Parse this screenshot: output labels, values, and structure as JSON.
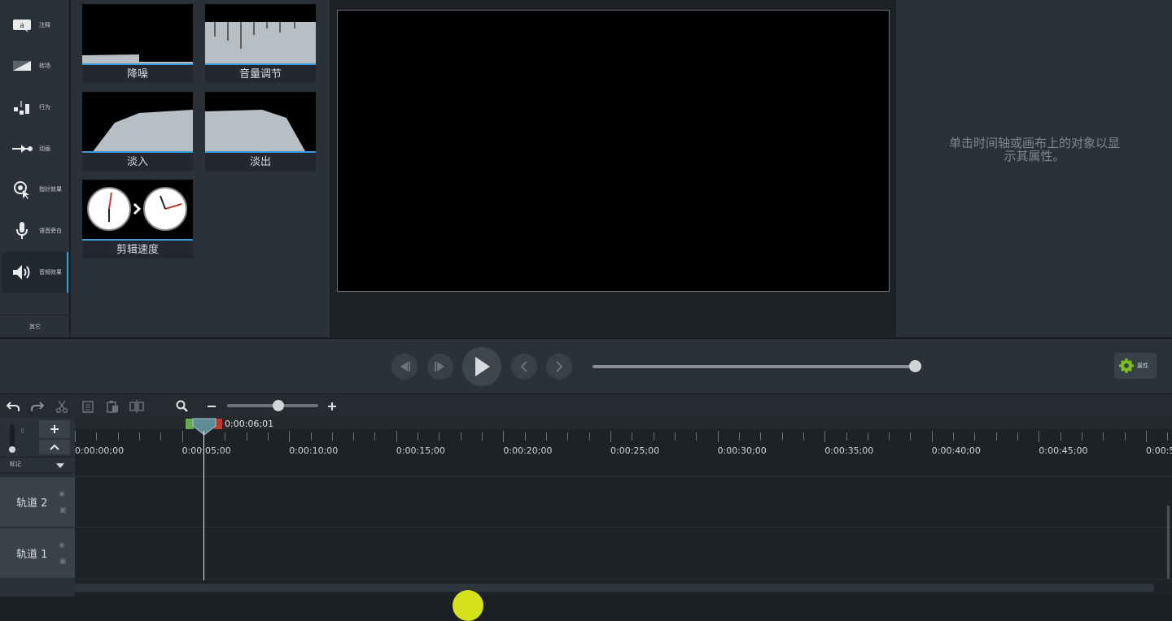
{
  "sidebar": {
    "items": [
      {
        "label": "注释",
        "icon": "annotation-icon"
      },
      {
        "label": "转场",
        "icon": "transition-icon"
      },
      {
        "label": "行为",
        "icon": "behavior-icon"
      },
      {
        "label": "动画",
        "icon": "animation-icon"
      },
      {
        "label": "指针效果",
        "icon": "cursor-effect-icon"
      },
      {
        "label": "语音旁白",
        "icon": "microphone-icon"
      },
      {
        "label": "音频效果",
        "icon": "speaker-icon"
      }
    ],
    "active_index": 6,
    "other_label": "其它"
  },
  "effects": {
    "items": [
      {
        "label": "降噪"
      },
      {
        "label": "音量调节"
      },
      {
        "label": "淡入"
      },
      {
        "label": "淡出"
      },
      {
        "label": "剪辑速度"
      }
    ]
  },
  "properties": {
    "empty_message_line1": "单击时间轴或画布上的对象以显",
    "empty_message_line2": "示其属性。",
    "button_label": "属性"
  },
  "playback": {
    "progress": 1.0
  },
  "timeline": {
    "zoom_level": 0.5,
    "playhead_time": "0:00:06;01",
    "marker_label": "标记",
    "tick_labels": [
      "0:00:00;00",
      "0:00:05;00",
      "0:00:10;00",
      "0:00:15;00",
      "0:00:20;00",
      "0:00:25;00",
      "0:00:30;00",
      "0:00:35;00",
      "0:00:40;00",
      "0:00:45;00",
      "0:00:5"
    ],
    "tracks": [
      {
        "name": "轨道 2"
      },
      {
        "name": "轨道 1"
      }
    ]
  },
  "colors": {
    "accent_blue": "#3a9bd9",
    "gear_green": "#7cc21d",
    "in_marker_green": "#6aa84f",
    "out_marker_red": "#c0392b",
    "playhead": "#5e8c99"
  }
}
